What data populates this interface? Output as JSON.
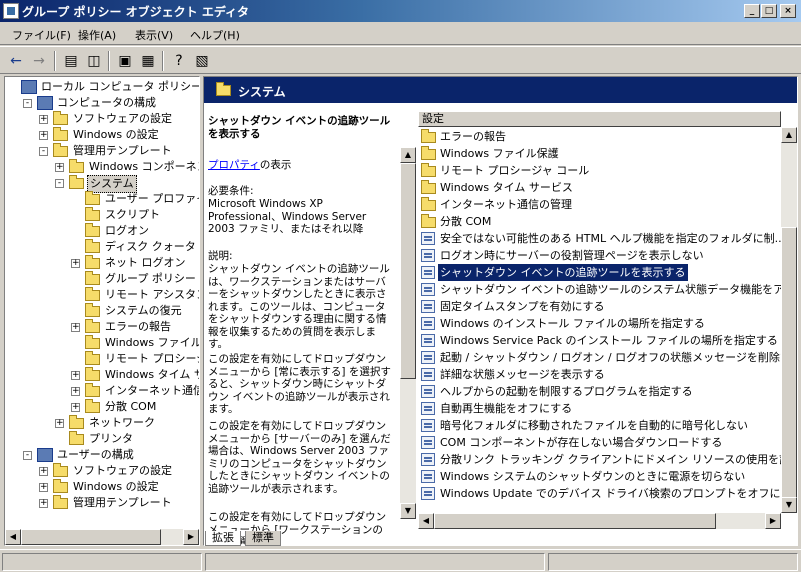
{
  "window": {
    "title": "グループ ポリシー オブジェクト エディタ"
  },
  "titlebar_buttons": [
    "_",
    "□",
    "×"
  ],
  "menu": [
    "ファイル(F)",
    "操作(A)",
    "表示(V)",
    "ヘルプ(H)"
  ],
  "tree": [
    {
      "label": "ローカル コンピュータ ポリシー",
      "level": 0,
      "icon": "computer-icon",
      "expander": ""
    },
    {
      "label": "コンピュータの構成",
      "level": 1,
      "icon": "computer-icon",
      "expander": "-"
    },
    {
      "label": "ソフトウェアの設定",
      "level": 2,
      "icon": "folder-icon",
      "expander": "+"
    },
    {
      "label": "Windows の設定",
      "level": 2,
      "icon": "folder-icon",
      "expander": "+"
    },
    {
      "label": "管理用テンプレート",
      "level": 2,
      "icon": "folder-icon",
      "expander": "-"
    },
    {
      "label": "Windows コンポーネント",
      "level": 3,
      "icon": "folder-icon",
      "expander": "+"
    },
    {
      "label": "システム",
      "level": 3,
      "icon": "folder-icon",
      "expander": "-",
      "selected": true
    },
    {
      "label": "ユーザー プロファイル",
      "level": 4,
      "icon": "folder-icon",
      "expander": ""
    },
    {
      "label": "スクリプト",
      "level": 4,
      "icon": "folder-icon",
      "expander": ""
    },
    {
      "label": "ログオン",
      "level": 4,
      "icon": "folder-icon",
      "expander": ""
    },
    {
      "label": "ディスク クォータ",
      "level": 4,
      "icon": "folder-icon",
      "expander": ""
    },
    {
      "label": "ネット ログオン",
      "level": 4,
      "icon": "folder-icon",
      "expander": "+"
    },
    {
      "label": "グループ ポリシー",
      "level": 4,
      "icon": "folder-icon",
      "expander": ""
    },
    {
      "label": "リモート アシスタンス",
      "level": 4,
      "icon": "folder-icon",
      "expander": ""
    },
    {
      "label": "システムの復元",
      "level": 4,
      "icon": "folder-icon",
      "expander": ""
    },
    {
      "label": "エラーの報告",
      "level": 4,
      "icon": "folder-icon",
      "expander": "+"
    },
    {
      "label": "Windows ファイル保護",
      "level": 4,
      "icon": "folder-icon",
      "expander": ""
    },
    {
      "label": "リモート プロシージャ コール",
      "level": 4,
      "icon": "folder-icon",
      "expander": ""
    },
    {
      "label": "Windows タイム サービス",
      "level": 4,
      "icon": "folder-icon",
      "expander": "+"
    },
    {
      "label": "インターネット通信の管理",
      "level": 4,
      "icon": "folder-icon",
      "expander": "+"
    },
    {
      "label": "分散 COM",
      "level": 4,
      "icon": "folder-icon",
      "expander": "+"
    },
    {
      "label": "ネットワーク",
      "level": 3,
      "icon": "folder-icon",
      "expander": "+"
    },
    {
      "label": "プリンタ",
      "level": 3,
      "icon": "folder-icon",
      "expander": ""
    },
    {
      "label": "ユーザーの構成",
      "level": 1,
      "icon": "user-icon",
      "expander": "-"
    },
    {
      "label": "ソフトウェアの設定",
      "level": 2,
      "icon": "folder-icon",
      "expander": "+"
    },
    {
      "label": "Windows の設定",
      "level": 2,
      "icon": "folder-icon",
      "expander": "+"
    },
    {
      "label": "管理用テンプレート",
      "level": 2,
      "icon": "folder-icon",
      "expander": "+"
    }
  ],
  "right_header": "システム",
  "description": {
    "title": "シャットダウン イベントの追跡ツールを表示する",
    "link": "プロパティ",
    "link_suffix": "の表示",
    "requirements_label": "必要条件:",
    "requirements": "Microsoft Windows XP Professional、Windows Server 2003 ファミリ、またはそれ以降",
    "explain_label": "説明:",
    "para1": "シャットダウン イベントの追跡ツールは、ワークステーションまたはサーバーをシャットダウンしたときに表示されます。このツールは、コンピュータをシャットダウンする理由に関する情報を収集するための質問を表示します。",
    "para2": "この設定を有効にしてドロップダウン メニューから [常に表示する] を選択すると、シャットダウン時にシャットダウン イベントの追跡ツールが表示されます。",
    "para3": "この設定を有効にしてドロップダウン メニューから [サーバーのみ] を選んだ場合は、Windows Server 2003 ファミリのコンピュータをシャットダウンしたときにシャットダウン イベントの追跡ツールが表示されます。",
    "para4": "この設定を有効にしてドロップダウン メニューから [ワークステーションのみ] を選ん"
  },
  "list_header": "設定",
  "list": [
    {
      "label": "エラーの報告",
      "icon": "folder-icon"
    },
    {
      "label": "Windows ファイル保護",
      "icon": "folder-icon"
    },
    {
      "label": "リモート プロシージャ コール",
      "icon": "folder-icon"
    },
    {
      "label": "Windows タイム サービス",
      "icon": "folder-icon"
    },
    {
      "label": "インターネット通信の管理",
      "icon": "folder-icon"
    },
    {
      "label": "分散 COM",
      "icon": "folder-icon"
    },
    {
      "label": "安全ではない可能性のある HTML ヘルプ機能を指定のフォルダに制...",
      "icon": "policy-icon"
    },
    {
      "label": "ログオン時にサーバーの役割管理ページを表示しない",
      "icon": "policy-icon"
    },
    {
      "label": "シャットダウン イベントの追跡ツールを表示する",
      "icon": "policy-icon",
      "selected": true
    },
    {
      "label": "シャットダウン イベントの追跡ツールのシステム状態データ機能をアク...",
      "icon": "policy-icon"
    },
    {
      "label": "固定タイムスタンプを有効にする",
      "icon": "policy-icon"
    },
    {
      "label": "Windows のインストール ファイルの場所を指定する",
      "icon": "policy-icon"
    },
    {
      "label": "Windows Service Pack のインストール ファイルの場所を指定する",
      "icon": "policy-icon"
    },
    {
      "label": "起動 / シャットダウン / ログオン / ログオフの状態メッセージを削除す...",
      "icon": "policy-icon"
    },
    {
      "label": "詳細な状態メッセージを表示する",
      "icon": "policy-icon"
    },
    {
      "label": "ヘルプからの起動を制限するプログラムを指定する",
      "icon": "policy-icon"
    },
    {
      "label": "自動再生機能をオフにする",
      "icon": "policy-icon"
    },
    {
      "label": "暗号化フォルダに移動されたファイルを自動的に暗号化しない",
      "icon": "policy-icon"
    },
    {
      "label": "COM コンポーネントが存在しない場合ダウンロードする",
      "icon": "policy-icon"
    },
    {
      "label": "分散リンク トラッキング クライアントにドメイン リソースの使用を許可す...",
      "icon": "policy-icon"
    },
    {
      "label": "Windows システムのシャットダウンのときに電源を切らない",
      "icon": "policy-icon"
    },
    {
      "label": "Windows Update でのデバイス ドライバ検索のプロンプトをオフにする",
      "icon": "policy-icon"
    }
  ],
  "tabs": [
    "拡張",
    "標準"
  ]
}
